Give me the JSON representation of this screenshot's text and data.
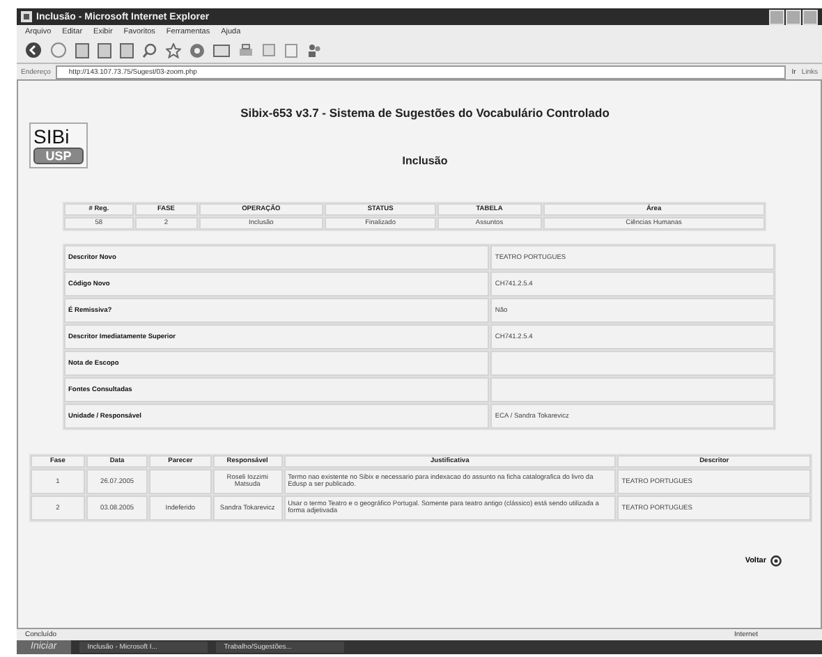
{
  "window": {
    "title": "Inclusão - Microsoft Internet Explorer"
  },
  "menu": [
    "Arquivo",
    "Editar",
    "Exibir",
    "Favoritos",
    "Ferramentas",
    "Ajuda"
  ],
  "address": {
    "label": "Endereço",
    "url": "http://143.107.73.75/Sugest/03-zoom.php",
    "go": "Ir",
    "links": "Links"
  },
  "page": {
    "title": "Sibix-653 v3.7 - Sistema de Sugestões do Vocabulário Controlado",
    "logo_top": "SIBi",
    "logo_bottom": "USP",
    "heading": "Inclusão",
    "summary": {
      "columns": [
        "# Reg.",
        "FASE",
        "OPERAÇÃO",
        "STATUS",
        "TABELA",
        "Área"
      ],
      "row": [
        "58",
        "2",
        "Inclusão",
        "Finalizado",
        "Assuntos",
        "Ciências Humanas"
      ]
    },
    "details": [
      {
        "label": "Descritor Novo",
        "value": "TEATRO PORTUGUES"
      },
      {
        "label": "Código Novo",
        "value": "CH741.2.5.4"
      },
      {
        "label": "É Remissiva?",
        "value": "Não"
      },
      {
        "label": "Descritor Imediatamente Superior",
        "value": "CH741.2.5.4"
      },
      {
        "label": "Nota de Escopo"
      },
      {
        "label": "Fontes Consultadas"
      },
      {
        "label": "Unidade / Responsável",
        "value": "ECA / Sandra Tokarevicz"
      }
    ],
    "history": {
      "columns": [
        "Fase",
        "Data",
        "Parecer",
        "Responsável",
        "Justificativa",
        "Descritor"
      ],
      "rows": [
        [
          "1",
          "26.07.2005",
          null,
          "Roseli Iozzimi Matsuda",
          "Termo nao existente no Sibix e necessario para indexacao do assunto na ficha catalografica do livro da Edusp a ser publicado.",
          "TEATRO PORTUGUES"
        ],
        [
          "2",
          "03.08.2005",
          "Indeferido",
          "Sandra Tokarevicz",
          "Usar o termo Teatro e o geográfico Portugal. Somente para teatro antigo (clássico) está sendo utilizada a forma adjetivada",
          "TEATRO PORTUGUES"
        ]
      ]
    },
    "back": "Voltar"
  },
  "status_bar": {
    "text": "Concluído",
    "zone": "Internet"
  },
  "taskbar": {
    "start": "Iniciar",
    "tasks": [
      "Inclusão - Microsoft I...",
      "Trabalho/Sugestões..."
    ]
  }
}
